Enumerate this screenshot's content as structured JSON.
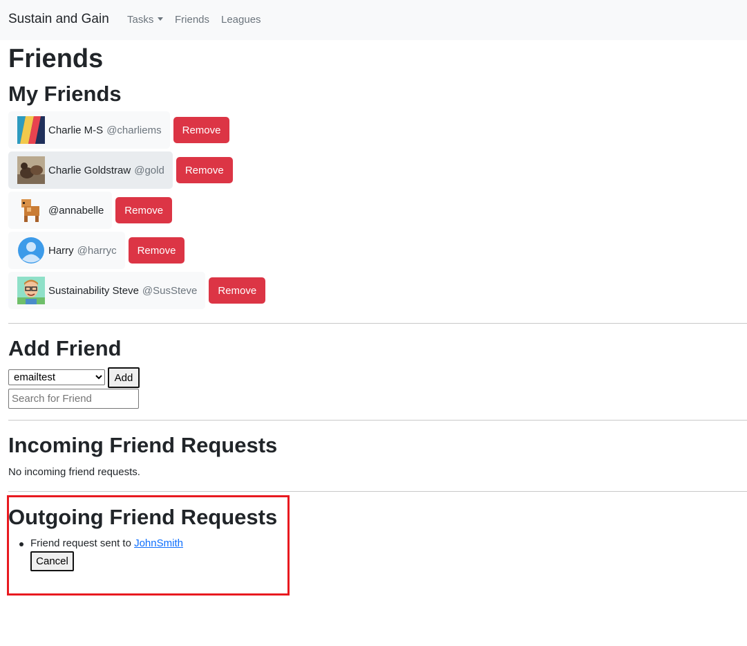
{
  "nav": {
    "brand": "Sustain and Gain",
    "items": [
      {
        "label": "Tasks",
        "has_dropdown": true
      },
      {
        "label": "Friends",
        "has_dropdown": false
      },
      {
        "label": "Leagues",
        "has_dropdown": false
      }
    ]
  },
  "page_title": "Friends",
  "my_friends": {
    "heading": "My Friends",
    "remove_label": "Remove",
    "friends": [
      {
        "name": "Charlie M-S",
        "username": "@charliems",
        "avatar": "stripes-avatar-icon"
      },
      {
        "name": "Charlie Goldstraw",
        "username": "@gold",
        "avatar": "dogs-photo-avatar-icon"
      },
      {
        "name": "",
        "username": "@annabelle",
        "avatar": "pixel-cow-avatar-icon"
      },
      {
        "name": "Harry",
        "username": "@harryc",
        "avatar": "default-user-avatar-icon"
      },
      {
        "name": "Sustainability Steve",
        "username": "@SusSteve",
        "avatar": "cartoon-man-avatar-icon"
      }
    ]
  },
  "add_friend": {
    "heading": "Add Friend",
    "selected_option": "emailtest",
    "add_label": "Add",
    "search_placeholder": "Search for Friend"
  },
  "incoming": {
    "heading": "Incoming Friend Requests",
    "empty_text": "No incoming friend requests."
  },
  "outgoing": {
    "heading": "Outgoing Friend Requests",
    "requests": [
      {
        "prefix": "Friend request sent to ",
        "user": "JohnSmith",
        "cancel_label": "Cancel"
      }
    ]
  },
  "colors": {
    "danger": "#dc3545",
    "navbar_bg": "#f8f9fa",
    "link": "#0d6efd",
    "highlight": "#e8191f"
  }
}
